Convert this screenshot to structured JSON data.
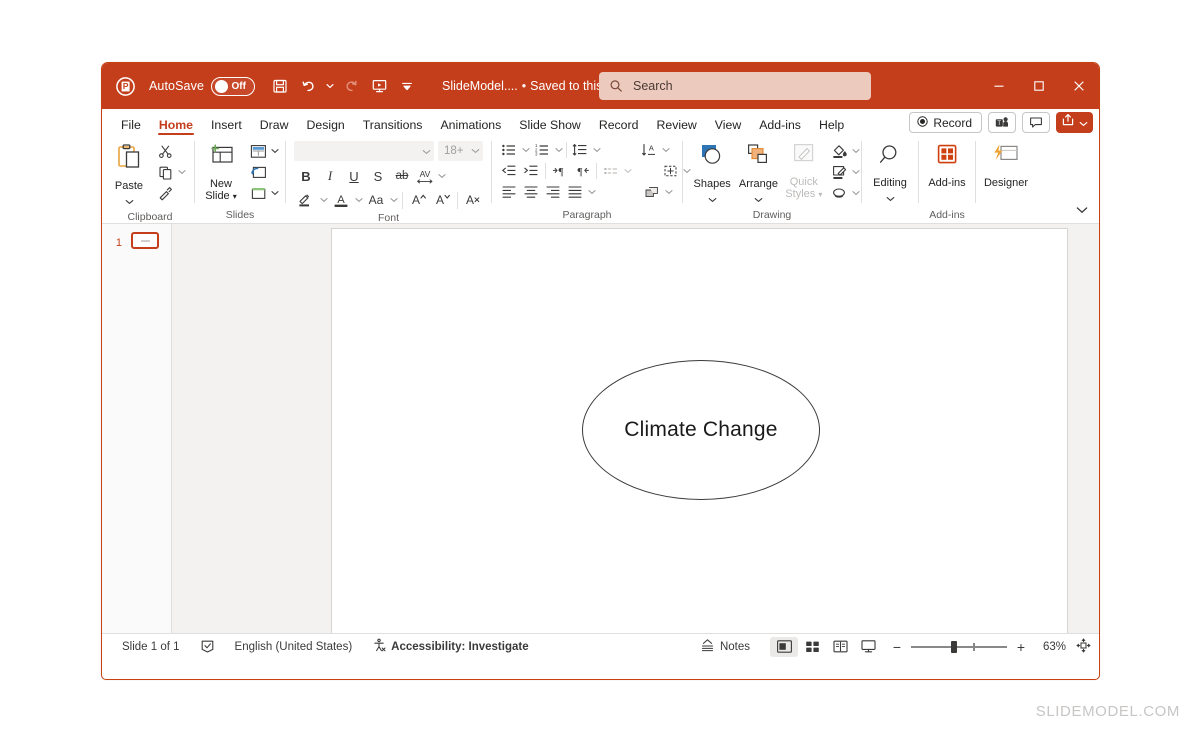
{
  "app": {
    "logo_icon": "powerpoint-logo-icon",
    "autosave_label": "AutoSave",
    "autosave_state": "Off",
    "document_title": "SlideModel....",
    "save_state": "Saved to this PC",
    "accent_color": "#c43e1c"
  },
  "quick_access": [
    {
      "name": "save-icon",
      "tooltip": "Save"
    },
    {
      "name": "undo-icon",
      "tooltip": "Undo"
    },
    {
      "name": "redo-icon",
      "tooltip": "Redo"
    },
    {
      "name": "start-presentation-icon",
      "tooltip": "Start From Beginning"
    },
    {
      "name": "customize-quick-access-toolbar-icon",
      "tooltip": "Customize Quick Access Toolbar"
    }
  ],
  "search": {
    "placeholder": "Search",
    "icon": "search-icon"
  },
  "window_controls": [
    {
      "name": "minimize-button",
      "glyph": "─"
    },
    {
      "name": "maximize-button",
      "glyph": "□"
    },
    {
      "name": "close-button",
      "glyph": "✕"
    }
  ],
  "ribbon": {
    "tabs": [
      {
        "label": "File",
        "active": false
      },
      {
        "label": "Home",
        "active": true
      },
      {
        "label": "Insert",
        "active": false
      },
      {
        "label": "Draw",
        "active": false
      },
      {
        "label": "Design",
        "active": false
      },
      {
        "label": "Transitions",
        "active": false
      },
      {
        "label": "Animations",
        "active": false
      },
      {
        "label": "Slide Show",
        "active": false
      },
      {
        "label": "Record",
        "active": false
      },
      {
        "label": "Review",
        "active": false
      },
      {
        "label": "View",
        "active": false
      },
      {
        "label": "Add-ins",
        "active": false
      },
      {
        "label": "Help",
        "active": false
      }
    ],
    "right_buttons": {
      "record_label": "Record",
      "record_icon": "record-circle-icon",
      "teams_icon": "teams-presenter-icon",
      "comments_icon": "comment-icon",
      "share_icon": "share-icon",
      "share_caret": "chevron-down-icon"
    },
    "groups": [
      {
        "name": "Clipboard",
        "buttons": [
          {
            "label": "Paste",
            "icon": "paste-icon"
          },
          {
            "label": "Cut",
            "icon": "scissors-icon"
          },
          {
            "label": "Copy",
            "icon": "copy-icon"
          },
          {
            "label": "Format Painter",
            "icon": "format-painter-icon"
          }
        ]
      },
      {
        "name": "Slides",
        "buttons": [
          {
            "label": "New Slide",
            "icon": "new-slide-icon"
          },
          {
            "label": "Layout",
            "icon": "layout-icon"
          },
          {
            "label": "Reset",
            "icon": "reset-icon"
          },
          {
            "label": "Section",
            "icon": "section-icon"
          }
        ]
      },
      {
        "name": "Font",
        "font_name": "",
        "font_size": "18+",
        "buttons": [
          {
            "label": "Bold",
            "glyph": "B"
          },
          {
            "label": "Italic",
            "glyph": "I"
          },
          {
            "label": "Underline",
            "glyph": "U"
          },
          {
            "label": "Text Shadow",
            "glyph": "S"
          },
          {
            "label": "Strikethrough",
            "glyph": "ab"
          },
          {
            "label": "Character Spacing",
            "glyph": "AV"
          },
          {
            "label": "Text Highlight Color",
            "icon": "highlight-icon"
          },
          {
            "label": "Font Color",
            "icon": "font-color-icon"
          },
          {
            "label": "Change Case",
            "glyph": "Aa"
          },
          {
            "label": "Increase Font Size",
            "glyph": "A"
          },
          {
            "label": "Decrease Font Size",
            "glyph": "A"
          },
          {
            "label": "Clear All Formatting",
            "icon": "clear-formatting-icon"
          }
        ]
      },
      {
        "name": "Paragraph",
        "buttons": [
          {
            "label": "Bullets",
            "icon": "bullets-icon"
          },
          {
            "label": "Numbering",
            "icon": "numbering-icon"
          },
          {
            "label": "Line Spacing",
            "icon": "line-spacing-icon"
          },
          {
            "label": "Text Direction",
            "icon": "text-direction-icon"
          },
          {
            "label": "Decrease Indent",
            "icon": "decrease-indent-icon"
          },
          {
            "label": "Increase Indent",
            "icon": "increase-indent-icon"
          },
          {
            "label": "Align Left",
            "icon": "align-left-icon"
          },
          {
            "label": "Align Center",
            "icon": "align-center-icon"
          },
          {
            "label": "Align Right",
            "icon": "align-right-icon"
          },
          {
            "label": "Justify",
            "icon": "justify-icon"
          },
          {
            "label": "Columns",
            "icon": "columns-icon"
          },
          {
            "label": "Align Text",
            "icon": "align-text-icon"
          },
          {
            "label": "Convert to SmartArt",
            "icon": "smartart-icon"
          }
        ]
      },
      {
        "name": "Drawing",
        "buttons": [
          {
            "label": "Shapes",
            "icon": "shapes-icon"
          },
          {
            "label": "Arrange",
            "icon": "arrange-icon"
          },
          {
            "label": "Quick Styles",
            "icon": "quick-styles-icon",
            "disabled": true
          },
          {
            "label": "Shape Fill",
            "icon": "shape-fill-icon"
          },
          {
            "label": "Shape Outline",
            "icon": "shape-outline-icon"
          },
          {
            "label": "Shape Effects",
            "icon": "shape-effects-icon"
          }
        ]
      },
      {
        "name": "",
        "buttons": [
          {
            "label": "Editing",
            "icon": "editing-search-icon"
          }
        ]
      },
      {
        "name": "Add-ins",
        "buttons": [
          {
            "label": "Add-ins",
            "icon": "addins-grid-icon"
          }
        ]
      },
      {
        "name": "",
        "buttons": [
          {
            "label": "Designer",
            "icon": "designer-icon"
          }
        ]
      }
    ],
    "collapse_icon": "chevron-down-icon"
  },
  "thumbnail_pane": {
    "slides": [
      {
        "number": "1",
        "selected": true
      }
    ]
  },
  "slide": {
    "shapes": [
      {
        "type": "ellipse",
        "text": "Climate Change",
        "outline_color": "#3a3a3a",
        "fill": "none"
      }
    ]
  },
  "statusbar": {
    "slide_count": "Slide 1 of 1",
    "notes_icon": "notes-icon",
    "language": "English (United States)",
    "accessibility_icon": "accessibility-icon",
    "accessibility": "Accessibility: Investigate",
    "notes_label": "Notes",
    "views": [
      {
        "name": "normal-view-button",
        "selected": true
      },
      {
        "name": "slide-sorter-view-button",
        "selected": false
      },
      {
        "name": "reading-view-button",
        "selected": false
      },
      {
        "name": "slide-show-button",
        "selected": false
      }
    ],
    "zoom_out": "−",
    "zoom_in": "+",
    "zoom_level": "63%",
    "fit_icon": "fit-to-window-icon"
  },
  "watermark": "SLIDEMODEL.COM"
}
